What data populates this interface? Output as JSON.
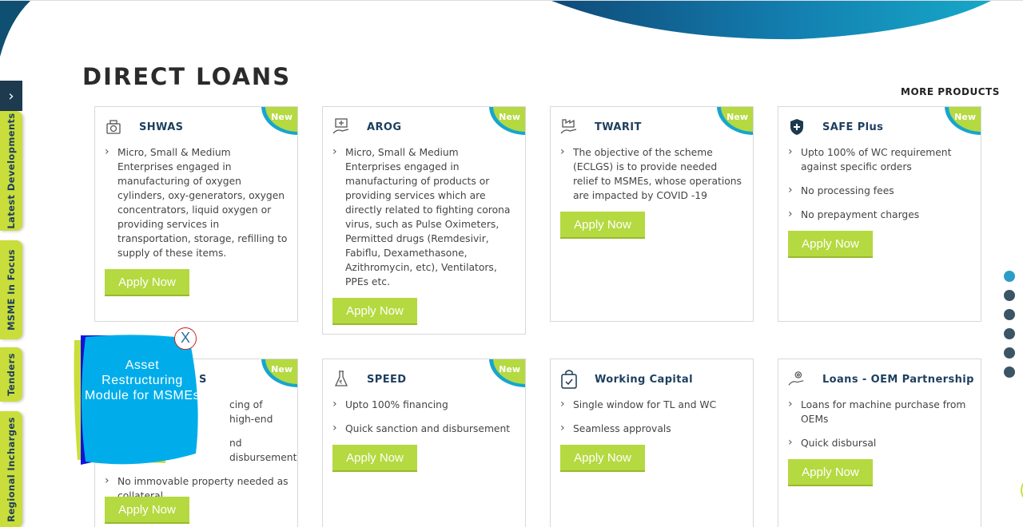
{
  "section": {
    "title": "DIRECT LOANS",
    "more_products": "MORE PRODUCTS"
  },
  "badge_text": "New",
  "apply_label": "Apply Now",
  "cards": [
    {
      "name": "SHWAS",
      "icon": "oxygen-cylinder-icon",
      "is_new": true,
      "items": [
        "Micro, Small & Medium Enterprises engaged in manufacturing of oxygen cylinders, oxy-generators, oxygen concentrators, liquid oxygen or providing services in transportation, storage, refilling to supply of these items."
      ]
    },
    {
      "name": "AROG",
      "icon": "medical-hand-icon",
      "is_new": true,
      "items": [
        "Micro, Small & Medium Enterprises engaged in manufacturing of products or providing services which are directly related to fighting corona virus, such as Pulse Oximeters, Permitted drugs (Remdesivir, Fabiflu, Dexamethasone, Azithromycin, etc), Ventilators, PPEs etc."
      ]
    },
    {
      "name": "TWARIT",
      "icon": "factory-hand-icon",
      "is_new": true,
      "items": [
        "The objective of the scheme (ECLGS) is to provide needed relief to MSMEs, whose operations are impacted by COVID -19"
      ]
    },
    {
      "name": "SAFE Plus",
      "icon": "shield-plus-icon",
      "is_new": true,
      "items": [
        "Upto 100% of WC requirement against specific orders",
        "No processing fees",
        "No prepayment charges"
      ]
    },
    {
      "name": "S",
      "icon": "machine-icon",
      "is_new": true,
      "items": [
        "cing of high-end",
        "nd disbursement",
        "No immovable property needed as collateral"
      ]
    },
    {
      "name": "SPEED",
      "icon": "rupee-flask-icon",
      "is_new": true,
      "items": [
        "Upto 100% financing",
        "Quick sanction and disbursement"
      ]
    },
    {
      "name": "Working Capital",
      "icon": "shopping-bag-icon",
      "is_new": false,
      "items": [
        "Single window for TL and WC",
        "Seamless approvals"
      ]
    },
    {
      "name": "Loans - OEM Partnership",
      "icon": "hand-gear-icon",
      "is_new": false,
      "items": [
        "Loans for machine purchase from OEMs",
        "Quick disbursal"
      ]
    }
  ],
  "side_tabs": [
    "Latest Developments",
    "MSME In Focus",
    "Tenders",
    "Regional Incharges"
  ],
  "popup": {
    "text": "Asset Restructuring Module for MSMEs",
    "close": "X"
  },
  "colors": {
    "accent_green": "#b5d940",
    "navy": "#1d3f5e",
    "teal": "#16a5cf",
    "popup_blue": "#00adea"
  }
}
